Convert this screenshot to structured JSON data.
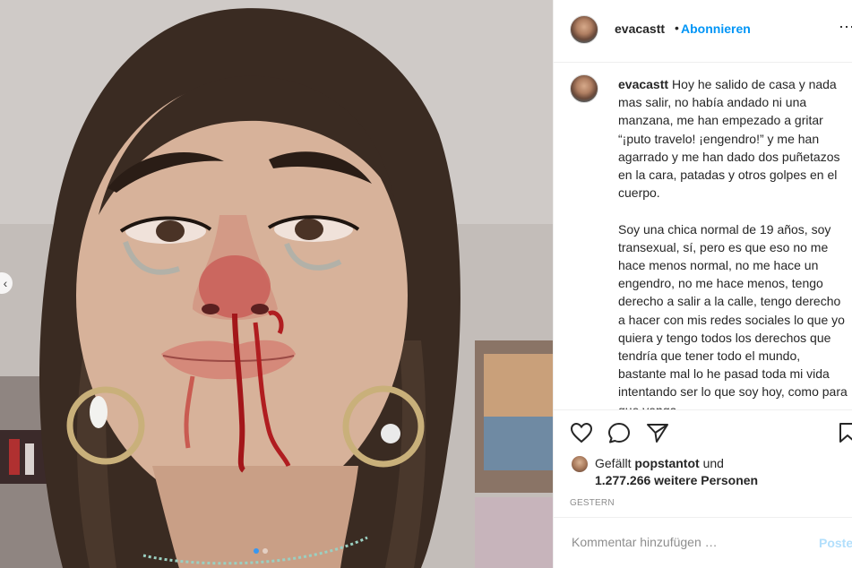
{
  "media": {
    "carousel_count": 2,
    "active_index": 0
  },
  "header": {
    "username": "evacastt",
    "bullet": "•",
    "follow_label": "Abonnieren"
  },
  "caption": {
    "username": "evacastt",
    "text": "Hoy he salido de casa y nada mas salir, no había andado ni una manzana, me han empezado a gritar “¡puto travelo! ¡engendro!” y me han agarrado y me han dado dos puñetazos en la cara, patadas y otros golpes en el cuerpo.\n\nSoy una chica normal de 19 años, soy transexual, sí, pero es que eso no me hace menos normal, no me hace un engendro, no me hace menos, tengo derecho a salir a la calle, tengo derecho a hacer con mis redes sociales lo que yo quiera y tengo todos los derechos que tendría que tener todo el mundo, bastante mal lo he pasad toda mi vida intentando ser lo que soy hoy, como para que venga"
  },
  "likes": {
    "prefix": "Gefällt",
    "user": "popstantot",
    "connector": "und",
    "count": "1.277.266 weitere Personen"
  },
  "timestamp": "Gestern",
  "comment": {
    "placeholder": "Kommentar hinzufügen …",
    "post_label": "Posten"
  },
  "icons": {
    "like": "heart-icon",
    "comment": "speech-bubble-icon",
    "share": "paper-plane-icon",
    "save": "bookmark-icon",
    "more": "more-options-icon",
    "prev": "chevron-left-icon"
  },
  "colors": {
    "accent": "#0095f6",
    "text": "#262626",
    "muted": "#8e8e8e",
    "post_disabled": "#b2dffc",
    "dot_active": "#3897f0"
  }
}
